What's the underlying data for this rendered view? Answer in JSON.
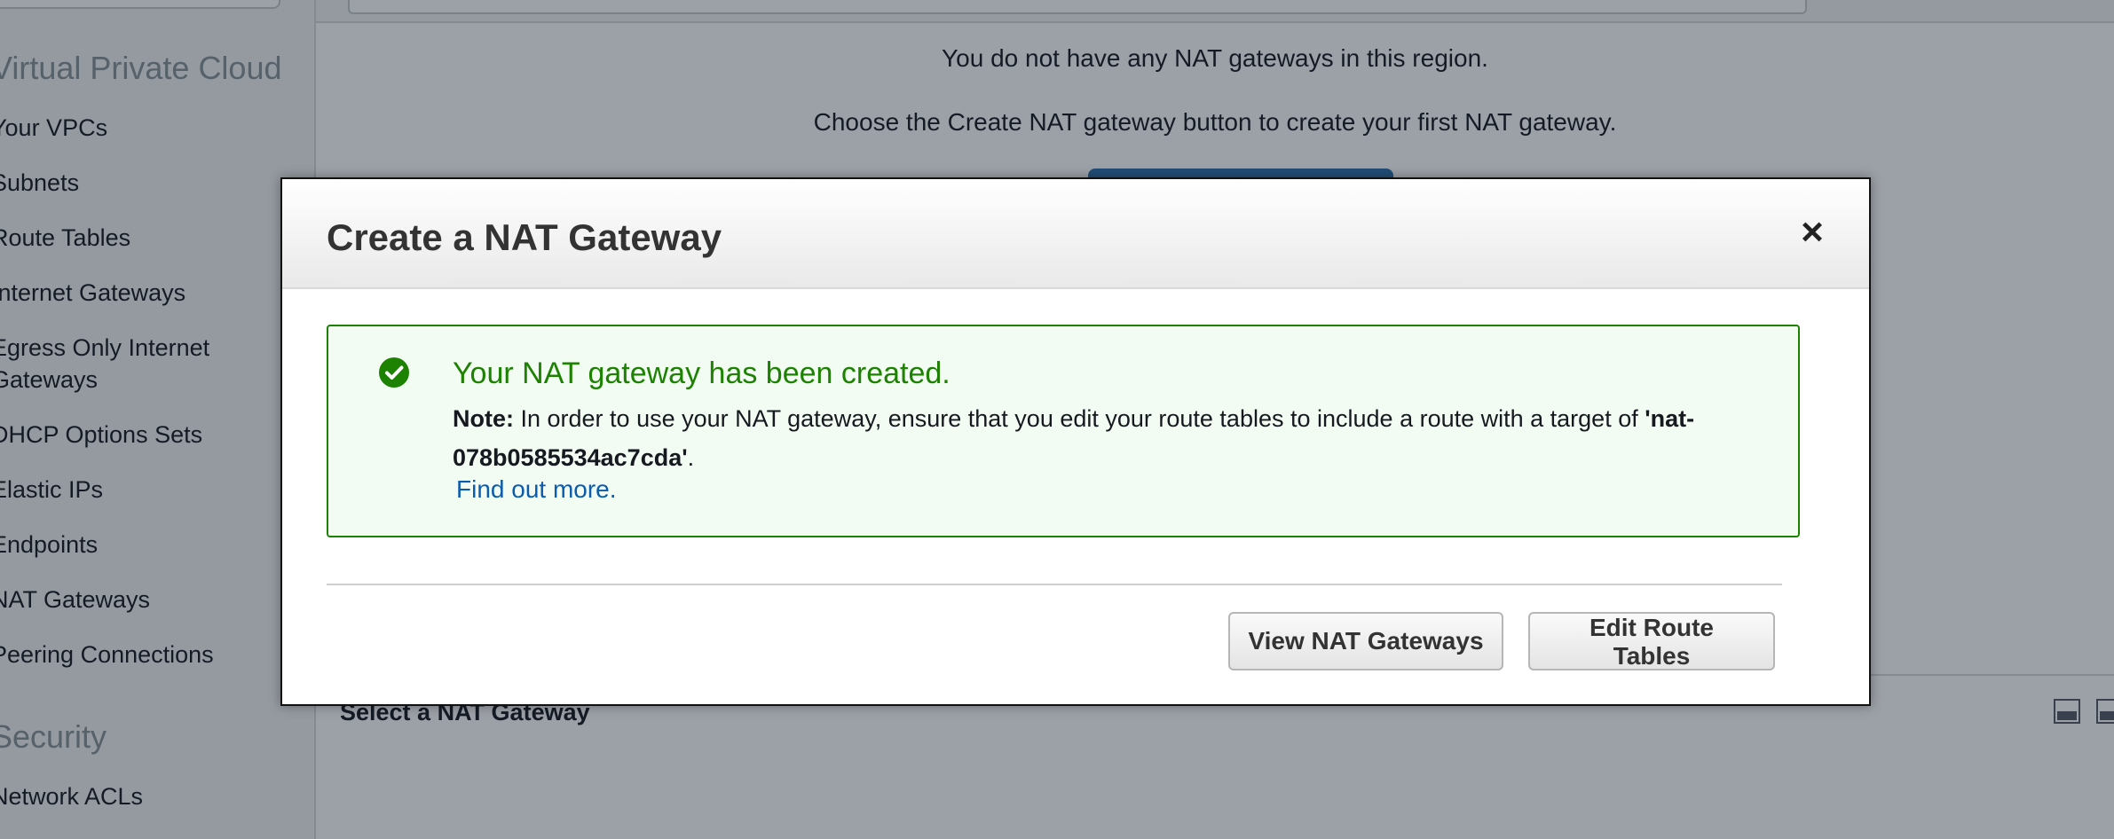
{
  "sidebar": {
    "section_vpc": "Virtual Private Cloud",
    "items": [
      "Your VPCs",
      "Subnets",
      "Route Tables",
      "Internet Gateways",
      "Egress Only Internet Gateways",
      "DHCP Options Sets",
      "Elastic IPs",
      "Endpoints",
      "NAT Gateways",
      "Peering Connections"
    ],
    "section_security": "Security",
    "security_items": [
      "Network ACLs"
    ]
  },
  "main": {
    "empty_line1": "You do not have any NAT gateways in this region.",
    "empty_line2": "Choose the Create NAT gateway button to create your first NAT gateway.",
    "lower_title": "Select a NAT Gateway"
  },
  "modal": {
    "title": "Create a NAT Gateway",
    "close_icon": "close-icon",
    "alert": {
      "icon": "check-circle-icon",
      "title": "Your NAT gateway has been created.",
      "note_label": "Note:",
      "note_text": " In order to use your NAT gateway, ensure that you edit your route tables to include a route with a target of ",
      "nat_id": "'nat-078b0585534ac7cda'",
      "note_end": ".",
      "link": "Find out more."
    },
    "buttons": {
      "view": "View NAT Gateways",
      "edit": "Edit Route Tables"
    }
  },
  "colors": {
    "success_green": "#1d8102",
    "link_blue": "#0b5cad",
    "overlay": "rgba(20,30,45,0.42)"
  }
}
